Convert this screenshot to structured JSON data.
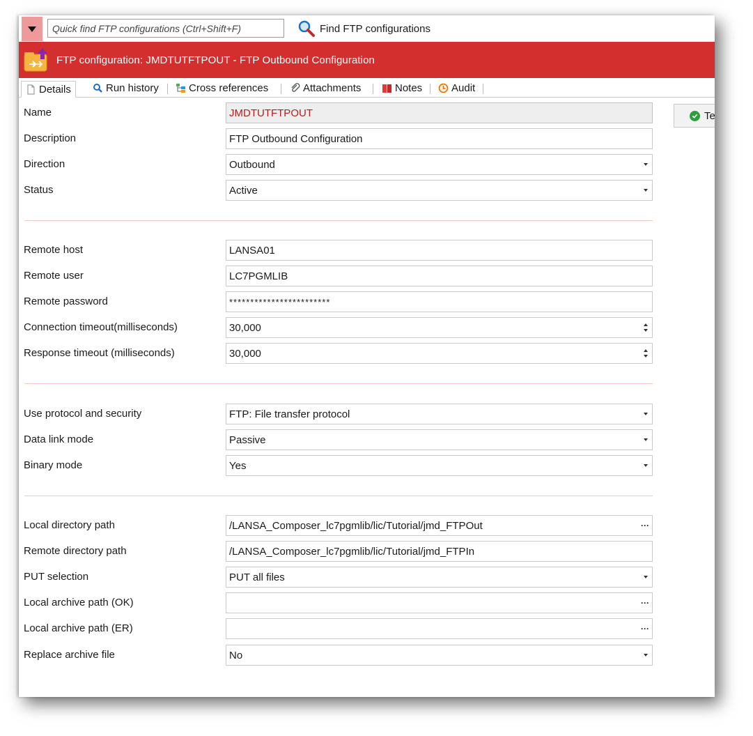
{
  "topbar": {
    "quick_find_placeholder": "Quick find FTP configurations (Ctrl+Shift+F)",
    "find_label": "Find FTP configurations"
  },
  "header": {
    "title": "FTP configuration: JMDTUTFTPOUT - FTP Outbound Configuration",
    "color": "#d32f2f"
  },
  "tabs": [
    {
      "label": "Details",
      "icon": "document-icon"
    },
    {
      "label": "Run history",
      "icon": "search-icon"
    },
    {
      "label": "Cross references",
      "icon": "tree-icon"
    },
    {
      "label": "Attachments",
      "icon": "paperclip-icon"
    },
    {
      "label": "Notes",
      "icon": "book-icon"
    },
    {
      "label": "Audit",
      "icon": "clock-icon"
    }
  ],
  "test_button": {
    "label": "Te"
  },
  "fields": {
    "name": {
      "label": "Name",
      "value": "JMDTUTFTPOUT"
    },
    "description": {
      "label": "Description",
      "value": "FTP Outbound Configuration"
    },
    "direction": {
      "label": "Direction",
      "value": "Outbound"
    },
    "status": {
      "label": "Status",
      "value": "Active"
    },
    "remote_host": {
      "label": "Remote host",
      "value": "LANSA01"
    },
    "remote_user": {
      "label": "Remote user",
      "value": "LC7PGMLIB"
    },
    "remote_password": {
      "label": "Remote password",
      "value": "************************"
    },
    "connection_timeout": {
      "label": "Connection timeout(milliseconds)",
      "value": "30,000"
    },
    "response_timeout": {
      "label": "Response timeout (milliseconds)",
      "value": "30,000"
    },
    "protocol": {
      "label": "Use protocol and security",
      "value": "FTP: File transfer protocol"
    },
    "data_link_mode": {
      "label": "Data link mode",
      "value": "Passive"
    },
    "binary_mode": {
      "label": "Binary mode",
      "value": "Yes"
    },
    "local_directory": {
      "label": "Local directory path",
      "value": "/LANSA_Composer_lc7pgmlib/lic/Tutorial/jmd_FTPOut"
    },
    "remote_directory": {
      "label": "Remote directory path",
      "value": "/LANSA_Composer_lc7pgmlib/lic/Tutorial/jmd_FTPIn"
    },
    "put_selection": {
      "label": "PUT selection",
      "value": "PUT all files"
    },
    "local_archive_ok": {
      "label": "Local archive path (OK)",
      "value": ""
    },
    "local_archive_er": {
      "label": "Local archive path (ER)",
      "value": ""
    },
    "replace_archive": {
      "label": "Replace archive file",
      "value": "No"
    }
  }
}
